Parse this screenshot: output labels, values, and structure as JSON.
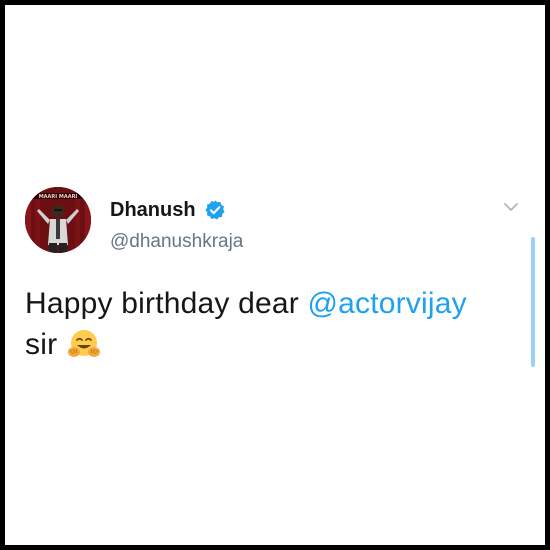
{
  "tweet": {
    "display_name": "Dhanush",
    "handle": "@dhanushkraja",
    "text_before": "Happy birthday dear ",
    "mention": "@actorvijay",
    "text_after": "sir"
  },
  "avatar": {
    "banner_text": "MAARI MAARI"
  },
  "icons": {
    "verified": "verified-badge-icon",
    "menu": "chevron-down-icon",
    "emoji": "hugging-face-emoji"
  },
  "colors": {
    "mention": "#1da1f2",
    "verified": "#1da1f2",
    "text": "#14171a",
    "handle": "#657786"
  }
}
